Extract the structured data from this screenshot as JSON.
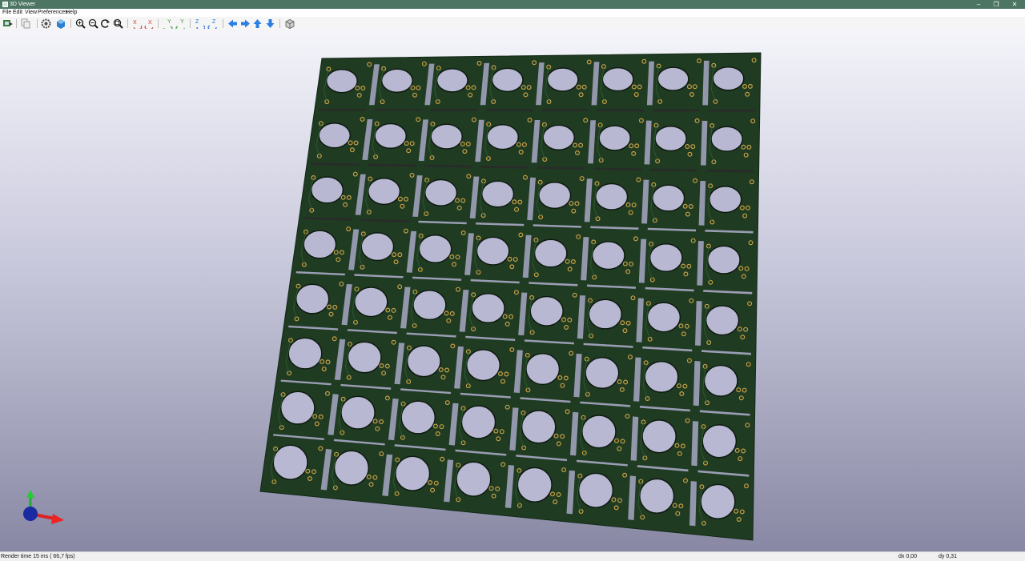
{
  "window": {
    "title": "3D Viewer",
    "minimize_glyph": "–",
    "maximize_glyph": "❐",
    "close_glyph": "✕"
  },
  "menu": [
    "File",
    "Edit",
    "View",
    "Preferences",
    "Help"
  ],
  "toolbar": {
    "buttons": [
      {
        "icon": "export-image-icon",
        "color": "#3a7d3a"
      },
      {
        "icon": "copy-image-icon",
        "color": "#9a9a9a"
      },
      {
        "icon": "3d-settings-icon",
        "color": "#4a4a4a"
      },
      {
        "icon": "raytracing-icon",
        "color": "#2a7fd0"
      },
      {
        "icon": "zoom-in-icon",
        "color": "#1d1d1d"
      },
      {
        "icon": "zoom-out-icon",
        "color": "#1d1d1d"
      },
      {
        "icon": "redraw-icon",
        "color": "#1d1d1d"
      },
      {
        "icon": "zoom-fit-icon",
        "color": "#1d1d1d"
      },
      {
        "icon": "rotate-x-cw-icon",
        "color": "#d03030"
      },
      {
        "icon": "rotate-x-ccw-icon",
        "color": "#d03030"
      },
      {
        "icon": "rotate-y-cw-icon",
        "color": "#3a9a3a"
      },
      {
        "icon": "rotate-y-ccw-icon",
        "color": "#3a9a3a"
      },
      {
        "icon": "rotate-z-cw-icon",
        "color": "#2a6fd0"
      },
      {
        "icon": "rotate-z-ccw-icon",
        "color": "#2a6fd0"
      },
      {
        "icon": "pan-left-icon",
        "color": "#2a7fe0"
      },
      {
        "icon": "pan-right-icon",
        "color": "#2a7fe0"
      },
      {
        "icon": "pan-up-icon",
        "color": "#2a7fe0"
      },
      {
        "icon": "pan-down-icon",
        "color": "#2a7fe0"
      },
      {
        "icon": "ortho-toggle-icon",
        "color": "#5a5a5a"
      }
    ]
  },
  "scene": {
    "board_color": "#1f3b22",
    "hole_color": "#b8b8d2",
    "pad_color": "#c8a046",
    "slot_color": "#a8a8c4",
    "grid_rows": 8,
    "grid_cols": 8
  },
  "status": {
    "render": "Render time 15 ms ( 66,7 fps)",
    "dx": "dx 0,00",
    "dy": "dy 0,31"
  }
}
